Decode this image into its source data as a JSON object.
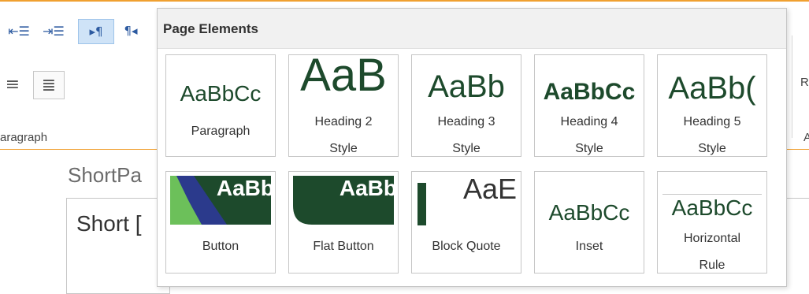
{
  "ribbon": {
    "group_label": "aragraph",
    "right_fragment_1": "R",
    "right_fragment_2": "A",
    "tools": [
      {
        "name": "decrease-indent-icon",
        "glyph": "⇤☰"
      },
      {
        "name": "increase-indent-icon",
        "glyph": "⇥☰"
      },
      {
        "name": "ltr-paragraph-icon",
        "glyph": "▸¶"
      },
      {
        "name": "rtl-paragraph-icon",
        "glyph": "¶◂"
      },
      {
        "name": "align-center-icon",
        "glyph": "≡"
      },
      {
        "name": "justify-icon",
        "glyph": "≣"
      }
    ]
  },
  "document": {
    "title": "ShortPa",
    "body_text": "Short ["
  },
  "panel": {
    "title": "Page Elements",
    "tiles": [
      {
        "sample": "AaBbCc",
        "caption_1": "Paragraph",
        "caption_2": ""
      },
      {
        "sample": "AaB",
        "caption_1": "Heading 2",
        "caption_2": "Style"
      },
      {
        "sample": "AaBb",
        "caption_1": "Heading 3",
        "caption_2": "Style"
      },
      {
        "sample": "AaBbCc",
        "caption_1": "Heading 4",
        "caption_2": "Style"
      },
      {
        "sample": "AaBb(",
        "caption_1": "Heading 5",
        "caption_2": "Style"
      },
      {
        "sample": "AaBb",
        "caption_1": "Button",
        "caption_2": ""
      },
      {
        "sample": "AaBb",
        "caption_1": "Flat Button",
        "caption_2": ""
      },
      {
        "sample": "AaE",
        "caption_1": "Block Quote",
        "caption_2": ""
      },
      {
        "sample": "AaBbCc",
        "caption_1": "Inset",
        "caption_2": ""
      },
      {
        "sample": "AaBbCc",
        "caption_1": "Horizontal",
        "caption_2": "Rule"
      }
    ]
  },
  "colors": {
    "accent_orange": "#f0a030",
    "brand_green": "#1d4a2c",
    "button_navy": "#2b3a8c",
    "button_light_green": "#6cc05a"
  }
}
